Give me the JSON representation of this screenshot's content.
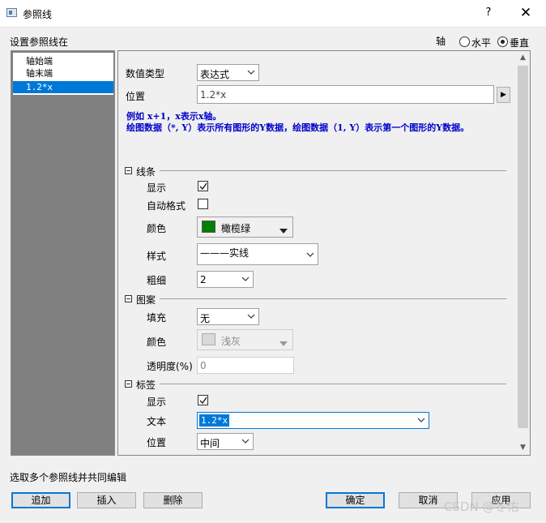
{
  "window": {
    "title": "参照线",
    "help": "?",
    "close": "✕"
  },
  "header": {
    "set_label": "设置参照线在",
    "axis_label": "轴",
    "radio_horizontal": "水平",
    "radio_vertical": "垂直",
    "selected_axis": "垂直"
  },
  "list": {
    "items": [
      "轴始端",
      "轴末端",
      "1.2*x"
    ],
    "selected_index": 2
  },
  "form": {
    "value_type_label": "数值类型",
    "value_type_value": "表达式",
    "position_label": "位置",
    "position_value": "1.2*x",
    "expand_arrow": "▶",
    "example_line1": "例如 x+1，x表示x轴。",
    "example_line2": "绘图数据（*, Y）表示所有图形的Y数据，绘图数据（1, Y）表示第一个图形的Y数据。"
  },
  "line_section": {
    "title": "线条",
    "show_label": "显示",
    "show_checked": true,
    "auto_format_label": "自动格式",
    "auto_format_checked": false,
    "color_label": "颜色",
    "color_value": "橄榄绿",
    "color_hex": "#008000",
    "style_label": "样式",
    "style_value": "———实线",
    "width_label": "粗细",
    "width_value": "2"
  },
  "pattern_section": {
    "title": "图案",
    "fill_label": "填充",
    "fill_value": "无",
    "color_label": "颜色",
    "color_value": "浅灰",
    "transparency_label": "透明度(%)",
    "transparency_value": "0"
  },
  "label_section": {
    "title": "标签",
    "show_label": "显示",
    "show_checked": true,
    "text_label": "文本",
    "text_value": "1.2*x",
    "position_label": "位置",
    "position_value": "中间"
  },
  "footer": {
    "hint": "选取多个参照线并共同编辑",
    "add": "追加",
    "insert": "插入",
    "delete": "删除",
    "ok": "确定",
    "cancel": "取消",
    "apply": "应用"
  },
  "watermark": "CSDN @冬佑"
}
